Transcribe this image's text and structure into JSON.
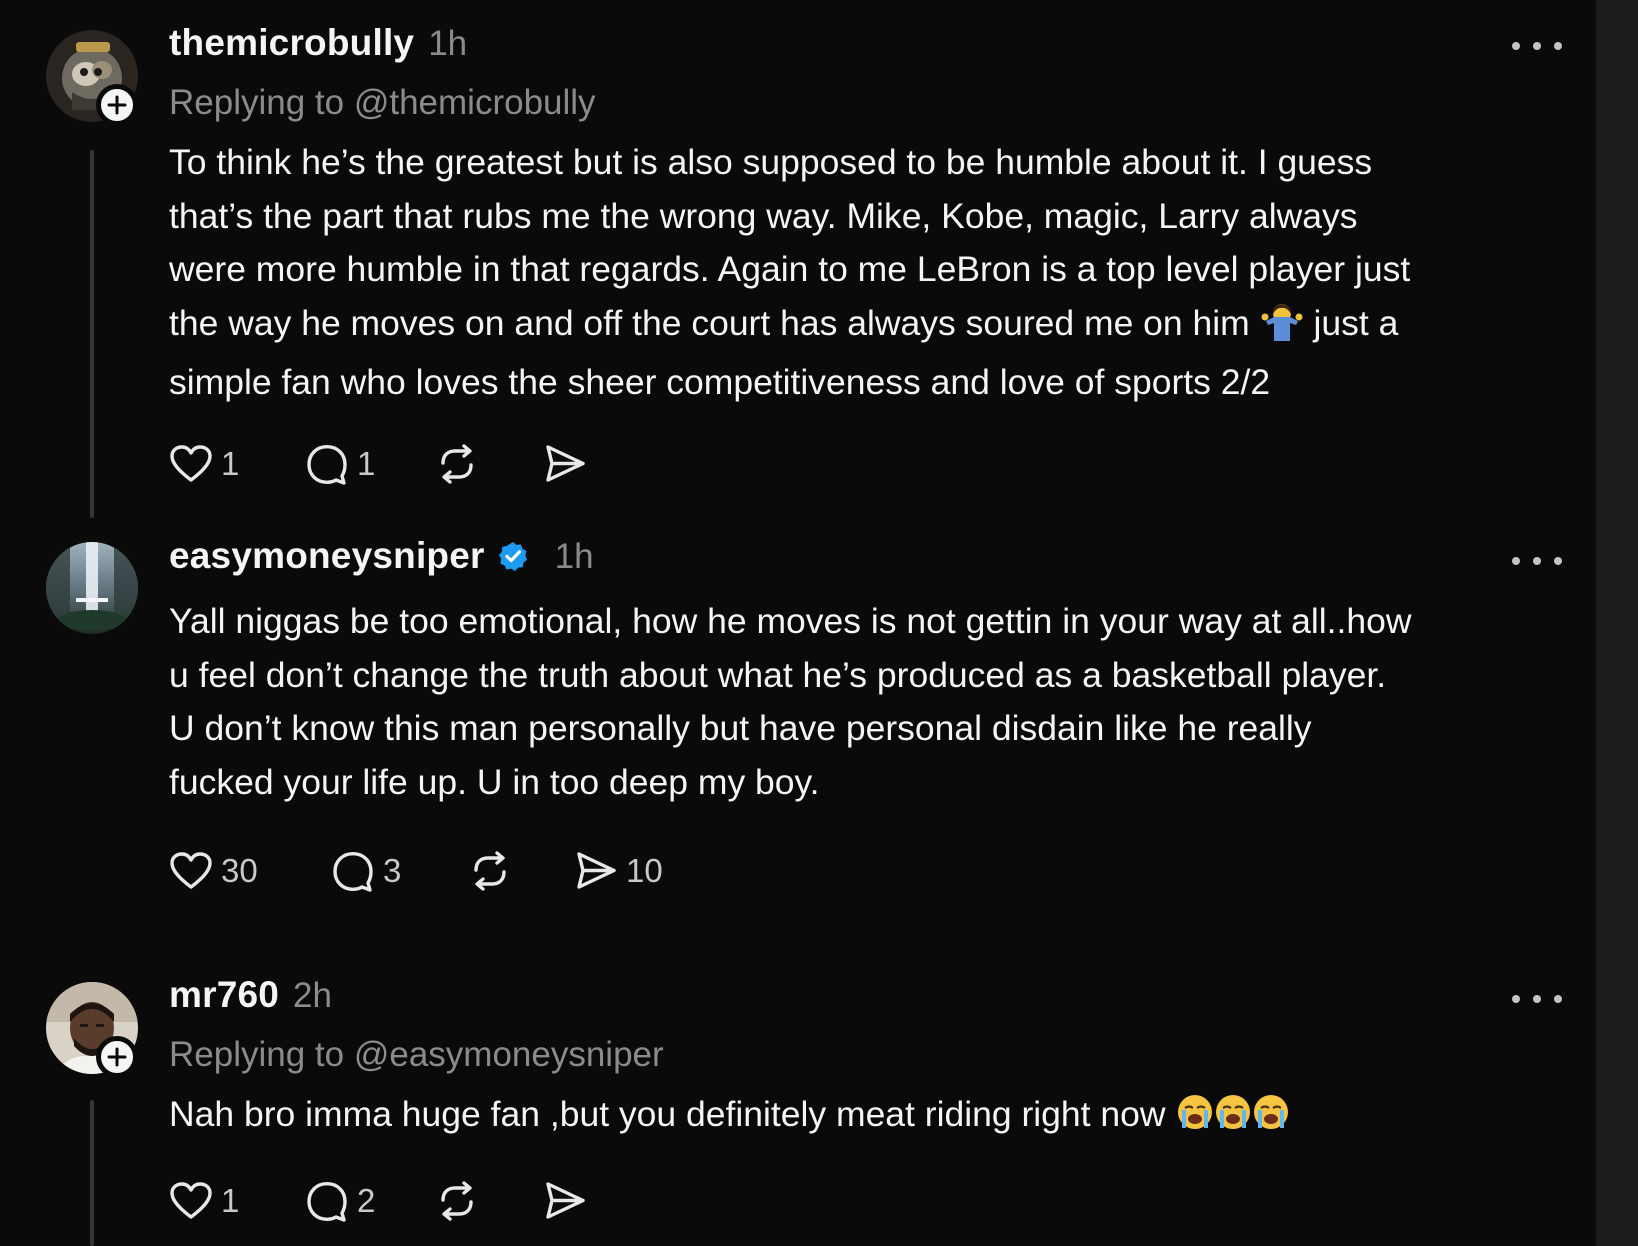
{
  "posts": [
    {
      "username": "themicrobully",
      "time": "1h",
      "replying_to": "Replying to @themicrobully",
      "text_main": "To think he’s the greatest but is also supposed to be humble about it. I guess\nthat’s the part that rubs me the wrong way. Mike, Kobe, magic, Larry always\nwere more humble in that regards. Again to me LeBron is a top level player just\nthe way he moves on and off the court has always soured me on him ",
      "emoji_mid": "man-shrugging-emoji",
      "text_tail": " just a\nsimple fan who loves the sheer competitiveness and love of sports 2/2",
      "likes": "1",
      "replies": "1",
      "reposts": "",
      "shares": ""
    },
    {
      "username": "easymoneysniper",
      "verified": true,
      "time": "1h",
      "text_main": "Yall niggas be too emotional, how he moves is not gettin in your way at all..how\nu feel don’t change the truth about what he’s produced as a basketball player.\nU don’t know this man personally but have personal disdain like he really\nfucked your life up. U in too deep my boy.",
      "likes": "30",
      "replies": "3",
      "reposts": "",
      "shares": "10"
    },
    {
      "username": "mr760",
      "time": "2h",
      "replying_to": "Replying to @easymoneysniper",
      "text_main": "Nah bro imma huge fan ,but you definitely meat riding right now ",
      "emoji_tail": "loudly-crying-face-emoji x3",
      "likes": "1",
      "replies": "2",
      "reposts": "",
      "shares": ""
    }
  ],
  "icons": {
    "like": "heart-icon",
    "reply": "comment-icon",
    "repost": "repost-icon",
    "share": "send-icon",
    "more": "more-dots-icon",
    "follow": "plus-icon",
    "verified": "verified-badge-icon"
  },
  "colors": {
    "background": "#0a0a0a",
    "text_primary": "#f3f5f7",
    "text_secondary": "#8b8b8b",
    "verified_blue": "#1d9bf0"
  }
}
